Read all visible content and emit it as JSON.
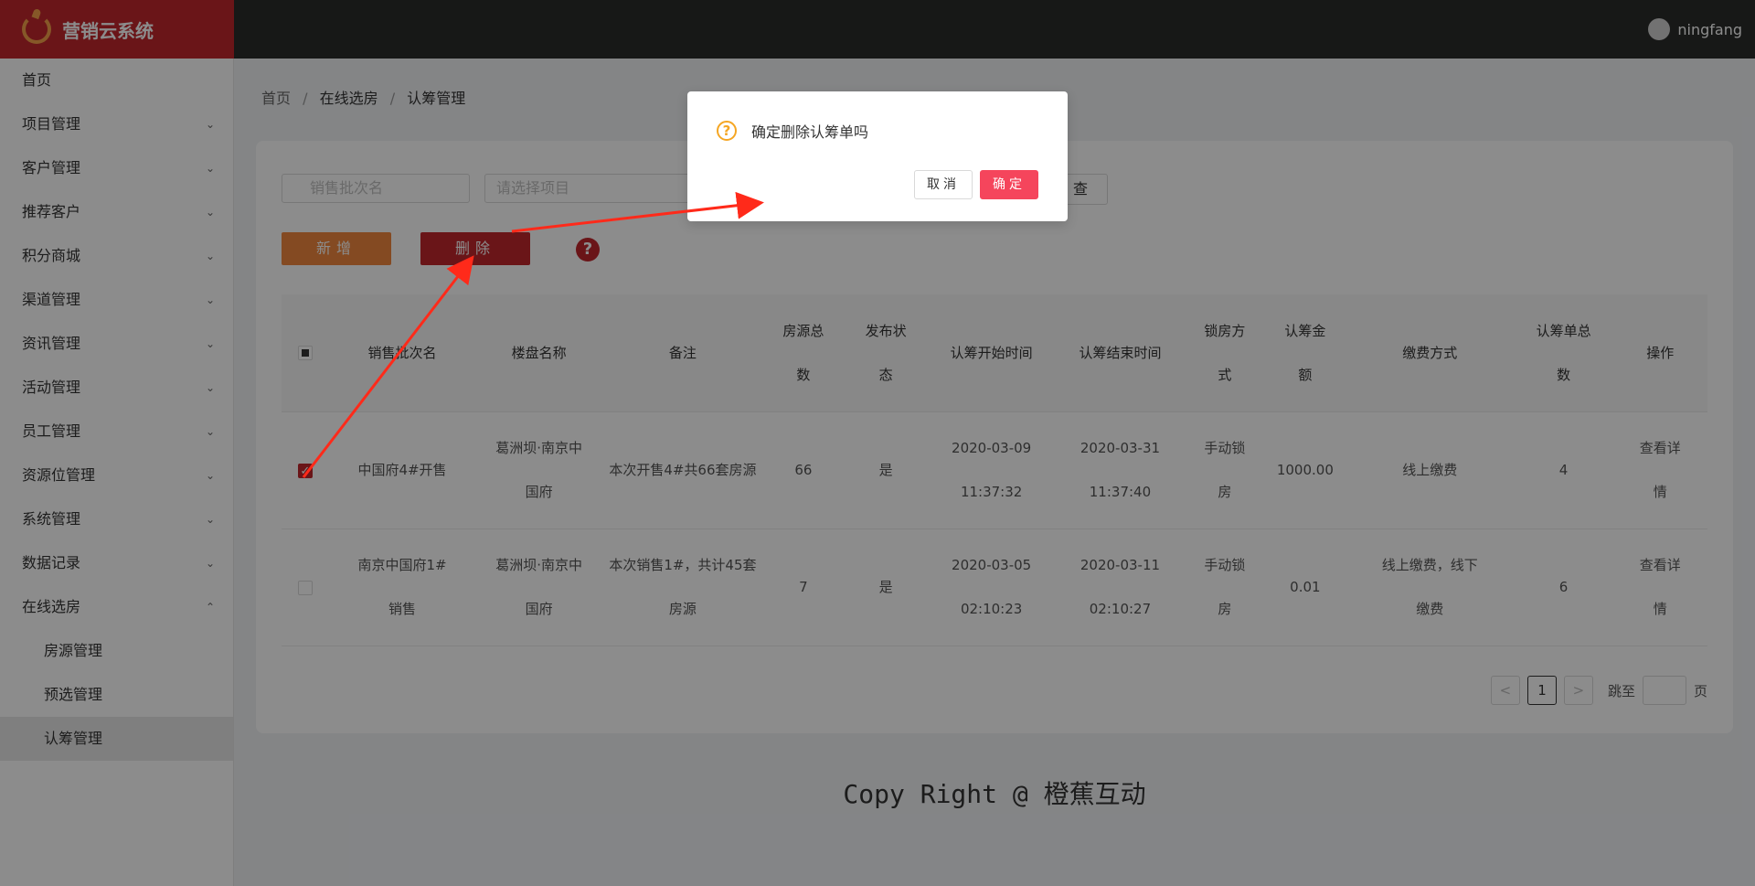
{
  "app": {
    "title": "营销云系统",
    "user": "ningfang"
  },
  "sidebar": {
    "items": [
      {
        "label": "首页",
        "has_chevron": false
      },
      {
        "label": "项目管理",
        "has_chevron": true
      },
      {
        "label": "客户管理",
        "has_chevron": true
      },
      {
        "label": "推荐客户",
        "has_chevron": true
      },
      {
        "label": "积分商城",
        "has_chevron": true
      },
      {
        "label": "渠道管理",
        "has_chevron": true
      },
      {
        "label": "资讯管理",
        "has_chevron": true
      },
      {
        "label": "活动管理",
        "has_chevron": true
      },
      {
        "label": "员工管理",
        "has_chevron": true
      },
      {
        "label": "资源位管理",
        "has_chevron": true
      },
      {
        "label": "系统管理",
        "has_chevron": true
      },
      {
        "label": "数据记录",
        "has_chevron": true
      },
      {
        "label": "在线选房",
        "expanded": true
      }
    ],
    "sub_items": [
      "房源管理",
      "预选管理",
      "认筹管理"
    ],
    "active_sub": "认筹管理",
    "chevron_down": "⌄",
    "chevron_up": "⌃"
  },
  "breadcrumb": [
    "首页",
    "在线选房",
    "认筹管理"
  ],
  "breadcrumb_sep": "/",
  "filters": {
    "batch_placeholder": "销售批次名",
    "project_placeholder": "请选择项目",
    "search_label": "查"
  },
  "toolbar": {
    "add_label": "新增",
    "delete_label": "删除",
    "help_icon": "?"
  },
  "table": {
    "headers": [
      "销售批次名",
      "楼盘名称",
      "备注",
      "房源总\n数",
      "发布状\n态",
      "认筹开始时间",
      "认筹结束时间",
      "锁房方\n式",
      "认筹金\n额",
      "缴费方式",
      "认筹单总\n数",
      "操作"
    ],
    "rows": [
      {
        "checked": true,
        "cells": [
          "中国府4#开售",
          "葛洲坝·南京中\n国府",
          "本次开售4#共66套房源",
          "66",
          "是",
          "2020-03-09\n11:37:32",
          "2020-03-31\n11:37:40",
          "手动锁\n房",
          "1000.00",
          "线上缴费",
          "4"
        ],
        "action": "查看详\n情"
      },
      {
        "checked": false,
        "cells": [
          "南京中国府1#\n销售",
          "葛洲坝·南京中\n国府",
          "本次销售1#，共计45套\n房源",
          "7",
          "是",
          "2020-03-05\n02:10:23",
          "2020-03-11\n02:10:27",
          "手动锁\n房",
          "0.01",
          "线上缴费，线下\n缴费",
          "6"
        ],
        "action": "查看详\n情"
      }
    ]
  },
  "pager": {
    "prev": "<",
    "current": "1",
    "next": ">",
    "jump_label": "跳至",
    "page_suffix": "页"
  },
  "footer": "Copy Right @ 橙蕉互动",
  "modal": {
    "message": "确定删除认筹单吗",
    "cancel_label": "取消",
    "ok_label": "确定",
    "icon": "?"
  },
  "colors": {
    "brand": "#c1272d",
    "accent": "#f0873e",
    "confirm": "#f5455c",
    "annotation": "#ff2a1a"
  }
}
